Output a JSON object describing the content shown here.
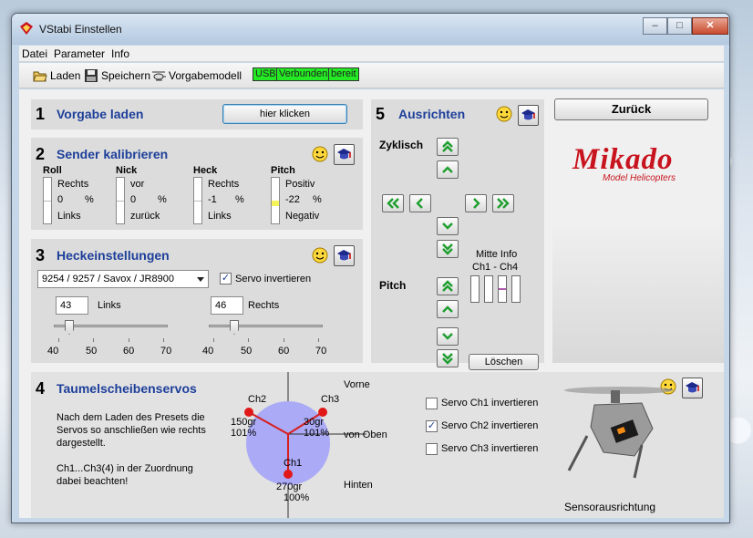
{
  "window": {
    "title": "VStabi Einstellen",
    "min": "–",
    "max": "□",
    "close": "✕",
    "icon": "vstabi-app-icon"
  },
  "menu": [
    "Datei",
    "Parameter",
    "Info"
  ],
  "toolbar": {
    "laden": "Laden",
    "speichern": "Speichern",
    "vorgabemodell": "Vorgabemodell",
    "status": [
      "USB",
      "Verbunden",
      "bereit"
    ],
    "status_color": "#23ea23"
  },
  "s1": {
    "num": "1",
    "title": "Vorgabe laden",
    "button": "hier klicken"
  },
  "s2": {
    "num": "2",
    "title": "Sender kalibrieren",
    "cols": [
      {
        "name": "Roll",
        "top": "Rechts",
        "value": "0",
        "unit": "%",
        "bottom": "Links",
        "level": 0
      },
      {
        "name": "Nick",
        "top": "vor",
        "value": "0",
        "unit": "%",
        "bottom": "zurück",
        "level": 0
      },
      {
        "name": "Heck",
        "top": "Rechts",
        "value": "-1",
        "unit": "%",
        "bottom": "Links",
        "level": -1
      },
      {
        "name": "Pitch",
        "top": "Positiv",
        "value": "-22",
        "unit": "%",
        "bottom": "Negativ",
        "level": -22
      }
    ]
  },
  "s3": {
    "num": "3",
    "title": "Heckeinstellungen",
    "servo": "9254 / 9257 / Savox / JR8900",
    "invert_label": "Servo invertieren",
    "invert_checked": true,
    "left": {
      "value": "43",
      "label": "Links",
      "pos": 43
    },
    "right": {
      "value": "46",
      "label": "Rechts",
      "pos": 46
    },
    "scale": [
      "40",
      "50",
      "60",
      "70"
    ]
  },
  "s4": {
    "num": "4",
    "title": "Taumelscheibenservos",
    "text1": "Nach dem Laden des Presets die",
    "text2": "Servos so anschließen wie rechts",
    "text3": "dargestellt.",
    "text4": "Ch1...Ch3(4) in der Zuordnung",
    "text5": "dabei beachten!",
    "vorne": "Vorne",
    "hinten": "Hinten",
    "von_oben": "von Oben",
    "ch2": "Ch2",
    "ch2_deg": "150gr",
    "ch2_pct": "101%",
    "ch3": "Ch3",
    "ch3_deg": "30gr",
    "ch3_pct": "101%",
    "ch1": "Ch1",
    "ch1_deg": "270gr",
    "ch1_pct": "100%",
    "servos": [
      {
        "label": "Servo Ch1 invertieren",
        "checked": false
      },
      {
        "label": "Servo Ch2 invertieren",
        "checked": true
      },
      {
        "label": "Servo Ch3 invertieren",
        "checked": false
      }
    ],
    "sensor": "Sensorausrichtung"
  },
  "s5": {
    "num": "5",
    "title": "Ausrichten",
    "zyklisch": "Zyklisch",
    "pitch": "Pitch",
    "mitte": "Mitte Info",
    "channels": "Ch1 - Ch4",
    "loeschen": "Löschen"
  },
  "back": "Zurück",
  "logo": {
    "brand": "Mikado",
    "sub": "Model Helicopters",
    "color": "#c8141e"
  }
}
